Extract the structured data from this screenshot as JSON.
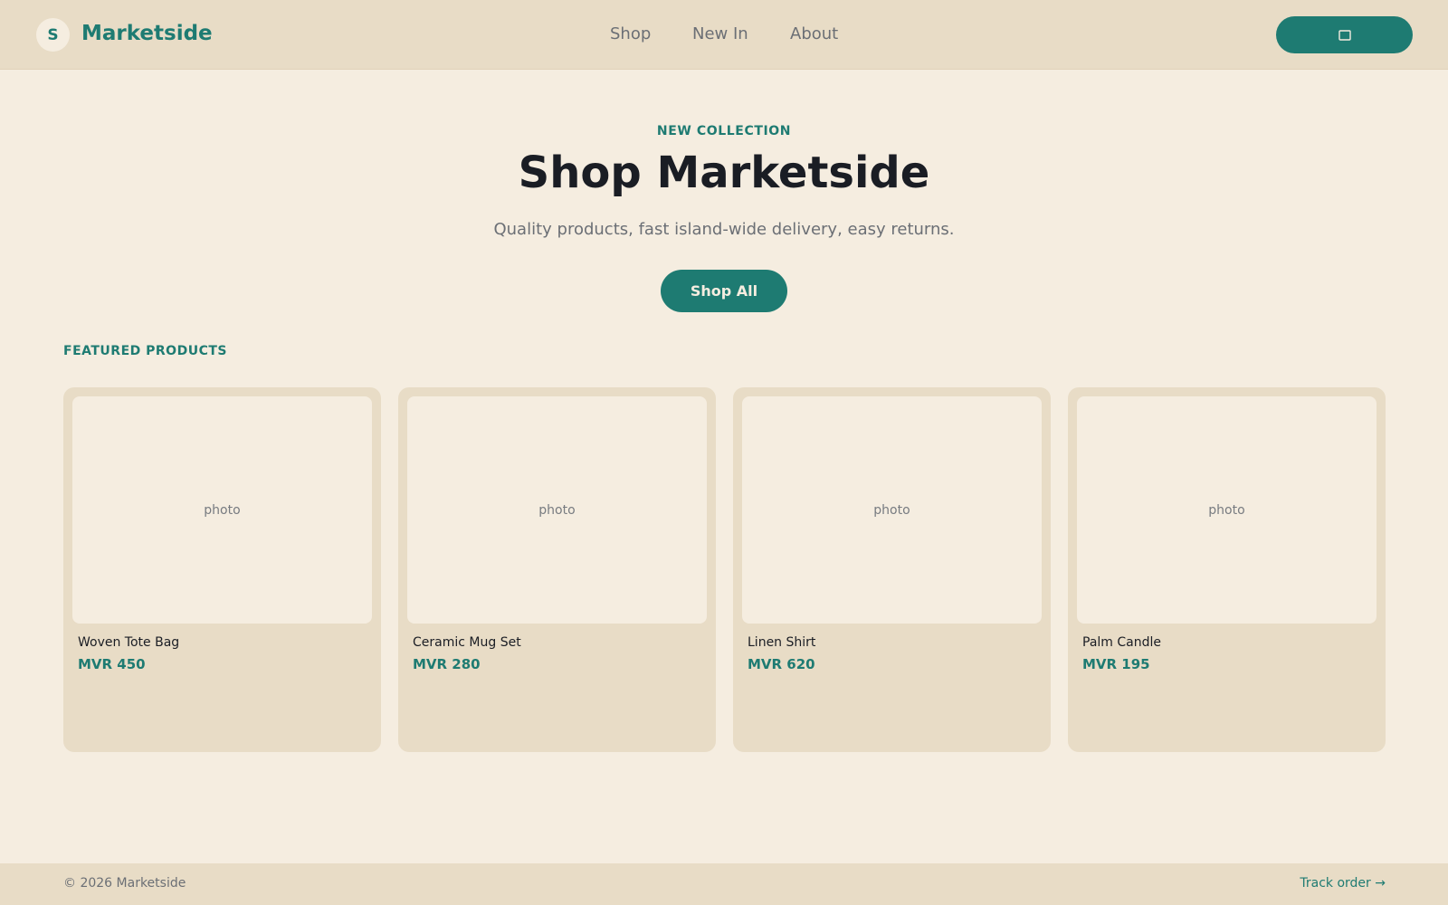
{
  "colors": {
    "accent": "#1e7b72",
    "background": "#f5ede0",
    "surface": "#e8dcc6",
    "text": "#1a1d24",
    "muted": "#6b6f75"
  },
  "header": {
    "logo_letter": "S",
    "brand": "Marketside",
    "nav": [
      "Shop",
      "New In",
      "About"
    ],
    "cart_icon": "cart-icon"
  },
  "hero": {
    "eyebrow": "NEW COLLECTION",
    "title": "Shop Marketside",
    "subtitle": "Quality products, fast island-wide delivery, easy returns.",
    "cta": "Shop All"
  },
  "featured": {
    "label": "FEATURED PRODUCTS",
    "products": [
      {
        "photo": "photo",
        "name": "Woven Tote Bag",
        "price": "MVR 450"
      },
      {
        "photo": "photo",
        "name": "Ceramic Mug Set",
        "price": "MVR 280"
      },
      {
        "photo": "photo",
        "name": "Linen Shirt",
        "price": "MVR 620"
      },
      {
        "photo": "photo",
        "name": "Palm Candle",
        "price": "MVR 195"
      }
    ]
  },
  "footer": {
    "copyright": "© 2026 Marketside",
    "track": "Track order →"
  }
}
